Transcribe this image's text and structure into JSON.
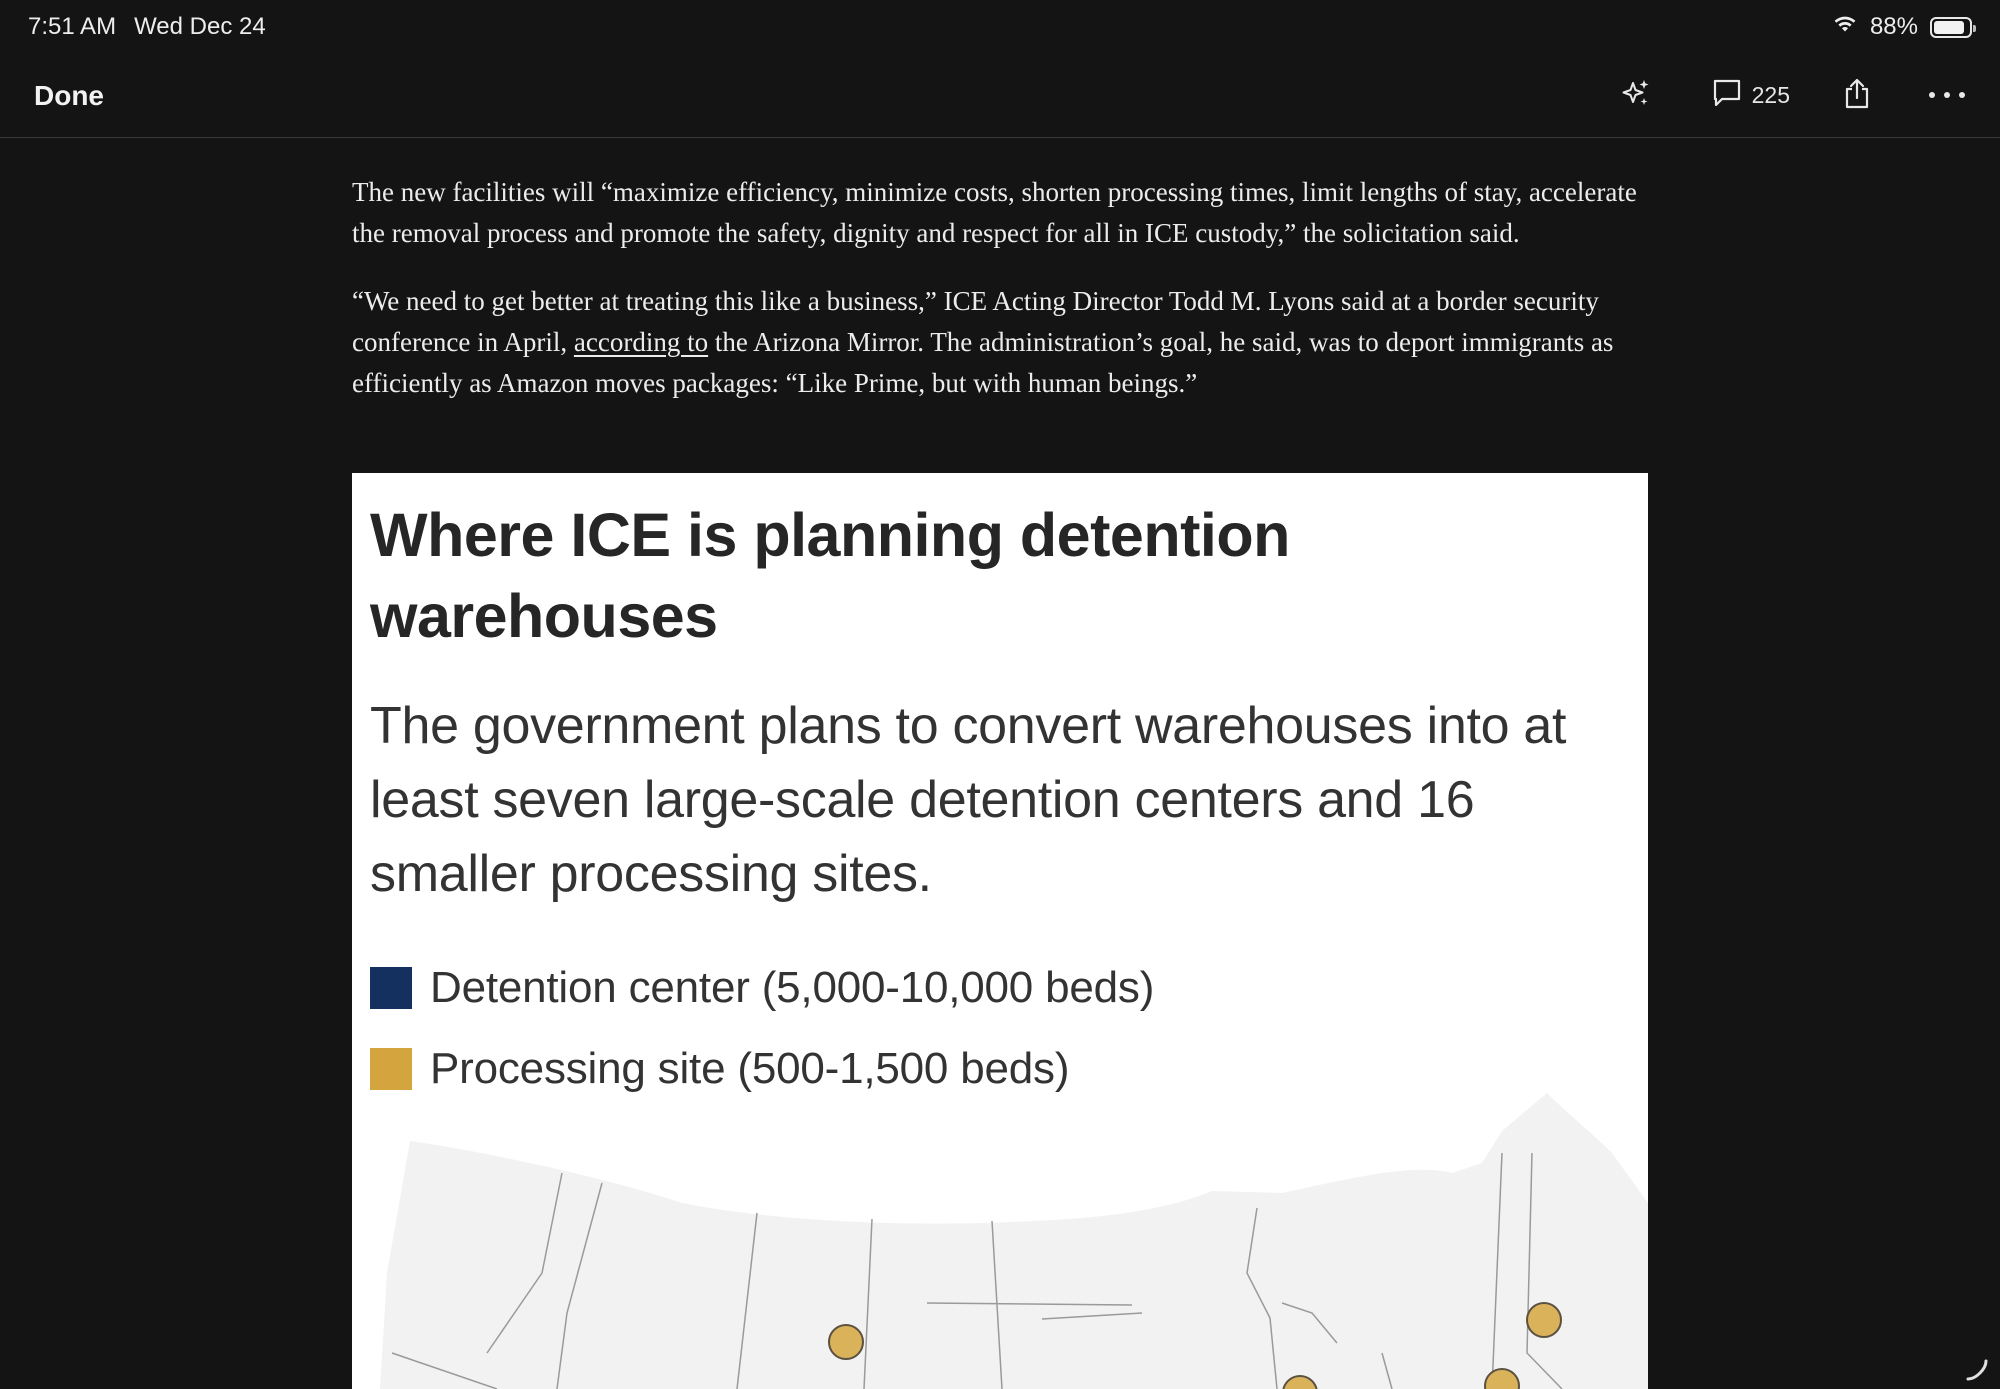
{
  "status_bar": {
    "time": "7:51 AM",
    "date": "Wed Dec 24",
    "battery_text": "88%",
    "battery_level": 0.88,
    "wifi_icon": "wifi-icon"
  },
  "toolbar": {
    "done_label": "Done",
    "comment_count": "225",
    "icons": [
      "sparkle-ai-icon",
      "comment-icon",
      "share-icon",
      "more-icon"
    ]
  },
  "article": {
    "paragraph_1": "The new facilities will “maximize efficiency, minimize costs, shorten processing times, limit lengths of stay, accelerate the removal process and promote the safety, dignity and respect for all in ICE custody,” the solicitation said.",
    "paragraph_2_before": "“We need to get better at treating this like a business,” ICE Acting Director Todd M. Lyons said at a border security conference in April, ",
    "paragraph_2_link": "according to",
    "paragraph_2_after": " the Arizona Mirror. The administration’s goal, he said, was to deport immigrants as efficiently as Amazon moves packages: “Like Prime, but with human beings.”"
  },
  "graphic": {
    "title": "Where ICE is planning detention warehouses",
    "subtitle": "The government plans to convert warehouses into at least seven large-scale detention centers and 16 smaller processing sites.",
    "legend": [
      {
        "label": "Detention center (5,000-10,000 beds)",
        "color": "#14305f"
      },
      {
        "label": "Processing site (500-1,500 beds)",
        "color": "#d4a53e"
      }
    ],
    "site_marker_color": "#d9b25a"
  }
}
